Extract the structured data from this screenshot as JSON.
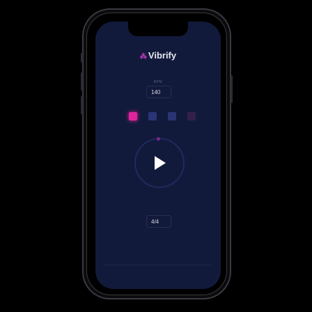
{
  "app": {
    "name": "Vibrify",
    "logo_mark": "⁂"
  },
  "tempo": {
    "label": "BPM",
    "value": "140"
  },
  "beats": [
    {
      "state": "active",
      "color": "#e0249c"
    },
    {
      "state": "inactive",
      "color": "#2a3476"
    },
    {
      "state": "inactive",
      "color": "#2a3476"
    },
    {
      "state": "inactive",
      "color": "#33204a"
    }
  ],
  "transport": {
    "icon": "play-icon"
  },
  "time_signature": {
    "value": "4/4"
  },
  "colors": {
    "screen_bg": "#121a3b",
    "accent": "#e0249c",
    "text": "#e8e8f0"
  }
}
